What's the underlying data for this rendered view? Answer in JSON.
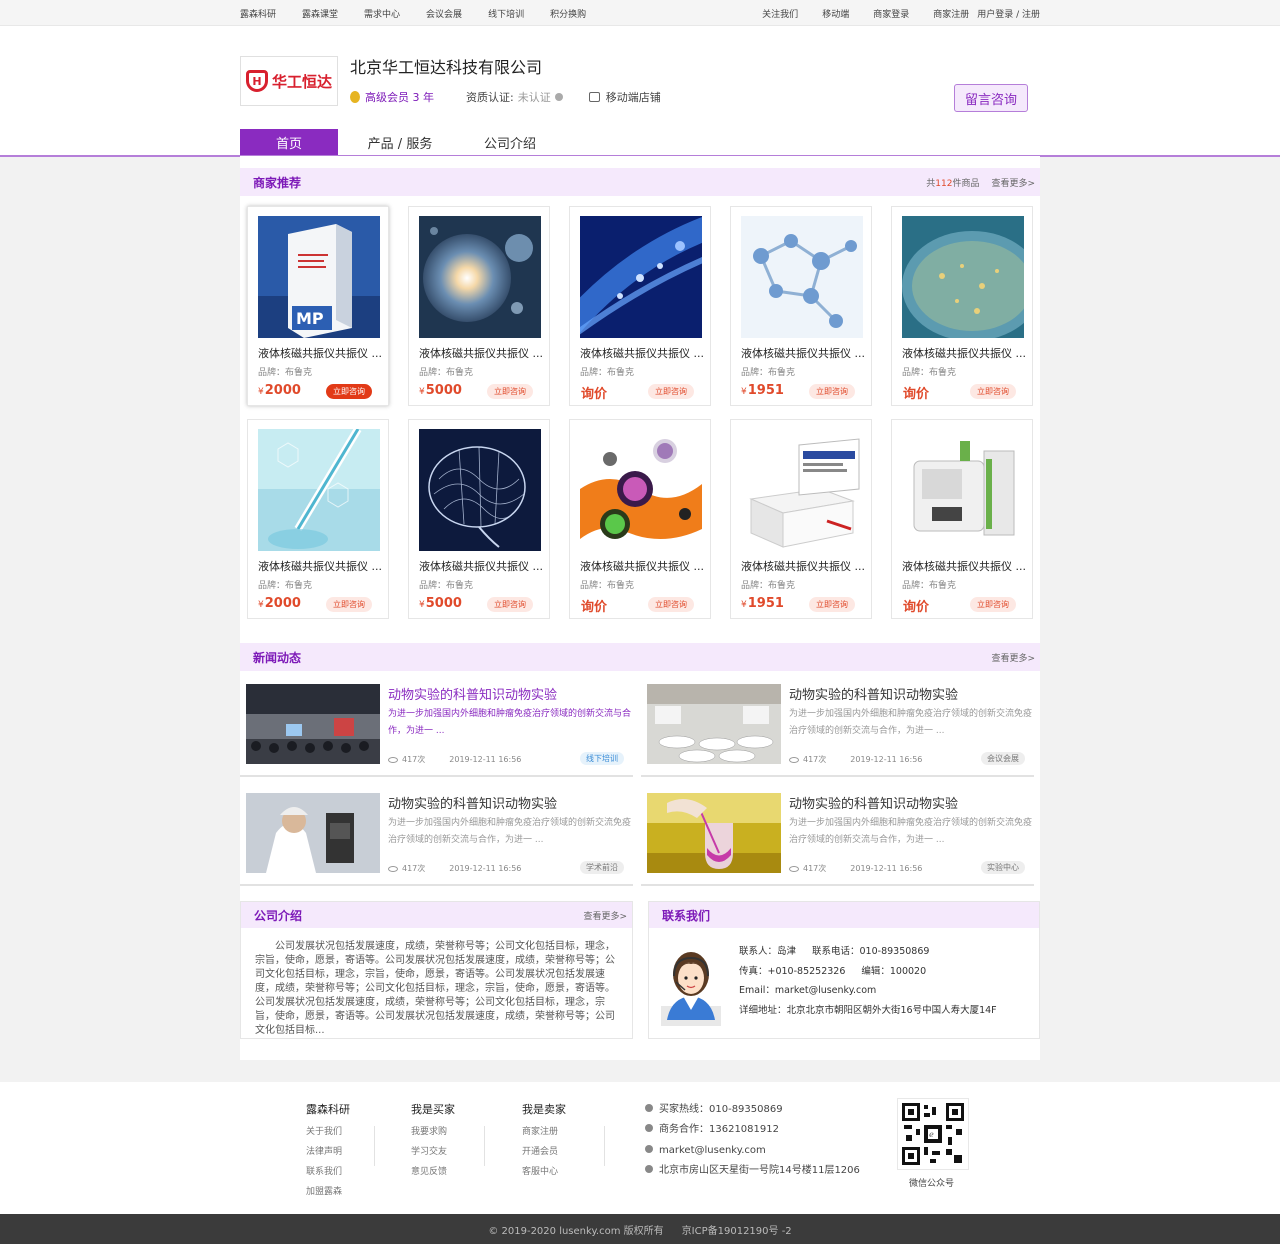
{
  "topnav": {
    "left": [
      "露森科研",
      "露森课堂",
      "需求中心",
      "会议会展",
      "线下培训",
      "积分换购"
    ],
    "right": [
      "关注我们",
      "移动端",
      "商家登录",
      "商家注册"
    ],
    "login": "用户登录 / 注册"
  },
  "header": {
    "logo_text": "华工恒达",
    "company_name": "北京华工恒达科技有限公司",
    "vip": "高级会员 3 年",
    "cert_label": "资质认证:",
    "cert_value": "未认证",
    "mobile_shop": "移动端店铺",
    "consult": "留言咨询"
  },
  "tabs": [
    "首页",
    "产品 / 服务",
    "公司介绍"
  ],
  "recommend": {
    "title": "商家推荐",
    "count_prefix": "共",
    "count": "112",
    "count_suffix": "件商品",
    "more": "查看更多>"
  },
  "products": [
    {
      "name": "液体核磁共振仪共振仪 ...",
      "brand": "品牌：布鲁克",
      "price": "2000",
      "yen": "¥",
      "btn": "立即咨询"
    },
    {
      "name": "液体核磁共振仪共振仪 ...",
      "brand": "品牌：布鲁克",
      "price": "5000",
      "yen": "¥",
      "btn": "立即咨询"
    },
    {
      "name": "液体核磁共振仪共振仪 ...",
      "brand": "品牌：布鲁克",
      "price": "询价",
      "yen": "",
      "btn": "立即咨询"
    },
    {
      "name": "液体核磁共振仪共振仪 ...",
      "brand": "品牌：布鲁克",
      "price": "1951",
      "yen": "¥",
      "btn": "立即咨询"
    },
    {
      "name": "液体核磁共振仪共振仪 ...",
      "brand": "品牌：布鲁克",
      "price": "询价",
      "yen": "",
      "btn": "立即咨询"
    },
    {
      "name": "液体核磁共振仪共振仪 ...",
      "brand": "品牌：布鲁克",
      "price": "2000",
      "yen": "¥",
      "btn": "立即咨询"
    },
    {
      "name": "液体核磁共振仪共振仪 ...",
      "brand": "品牌：布鲁克",
      "price": "5000",
      "yen": "¥",
      "btn": "立即咨询"
    },
    {
      "name": "液体核磁共振仪共振仪 ...",
      "brand": "品牌：布鲁克",
      "price": "询价",
      "yen": "",
      "btn": "立即咨询"
    },
    {
      "name": "液体核磁共振仪共振仪 ...",
      "brand": "品牌：布鲁克",
      "price": "1951",
      "yen": "¥",
      "btn": "立即咨询"
    },
    {
      "name": "液体核磁共振仪共振仪 ...",
      "brand": "品牌：布鲁克",
      "price": "询价",
      "yen": "",
      "btn": "立即咨询"
    }
  ],
  "news_section": {
    "title": "新闻动态",
    "more": "查看更多>"
  },
  "news": [
    {
      "title": "动物实验的科普知识动物实验",
      "desc": "为进一步加强国内外细胞和肿瘤免疫治疗领域的创新交流与合作，为进一 ...",
      "views": "417次",
      "date": "2019-12-11  16:56",
      "tag": "线下培训"
    },
    {
      "title": "动物实验的科普知识动物实验",
      "desc": "为进一步加强国内外细胞和肿瘤免疫治疗领域的创新交流免疫治疗领域的创新交流与合作，为进一 ...",
      "views": "417次",
      "date": "2019-12-11  16:56",
      "tag": "会议会展"
    },
    {
      "title": "动物实验的科普知识动物实验",
      "desc": "为进一步加强国内外细胞和肿瘤免疫治疗领域的创新交流免疫治疗领域的创新交流与合作，为进一 ...",
      "views": "417次",
      "date": "2019-12-11  16:56",
      "tag": "学术前沿"
    },
    {
      "title": "动物实验的科普知识动物实验",
      "desc": "为进一步加强国内外细胞和肿瘤免疫治疗领域的创新交流免疫治疗领域的创新交流与合作，为进一 ...",
      "views": "417次",
      "date": "2019-12-11  16:56",
      "tag": "实验中心"
    }
  ],
  "intro": {
    "title": "公司介绍",
    "more": "查看更多>",
    "text": "公司发展状况包括发展速度，成绩，荣誉称号等；公司文化包括目标，理念，宗旨，使命，愿景，寄语等。公司发展状况包括发展速度，成绩，荣誉称号等；公司文化包括目标，理念，宗旨，使命，愿景，寄语等。公司发展状况包括发展速度，成绩，荣誉称号等；公司文化包括目标，理念，宗旨，使命，愿景，寄语等。公司发展状况包括发展速度，成绩，荣誉称号等；公司文化包括目标，理念，宗旨，使命，愿景，寄语等。公司发展状况包括发展速度，成绩，荣誉称号等；公司文化包括目标..."
  },
  "contact": {
    "title": "联系我们",
    "person": "联系人：岛津",
    "phone": "联系电话：010-89350869",
    "fax": "传真：+010-85252326",
    "postcode": "编辑：100020",
    "email": "Email：market@lusenky.com",
    "address": "详细地址：北京北京市朝阳区朝外大街16号中国人寿大厦14F"
  },
  "footer": {
    "col1": {
      "title": "露森科研",
      "items": [
        "关于我们",
        "法律声明",
        "联系我们",
        "加盟露森"
      ]
    },
    "col2": {
      "title": "我是买家",
      "items": [
        "我要求购",
        "学习交友",
        "意见反馈"
      ]
    },
    "col3": {
      "title": "我是卖家",
      "items": [
        "商家注册",
        "开通会员",
        "客服中心"
      ]
    },
    "contact": [
      "买家热线：010-89350869",
      "商务合作：13621081912",
      "market@lusenky.com",
      "北京市房山区天星街一号院14号楼11层1206"
    ],
    "qr_label": "微信公众号",
    "copyright": "© 2019-2020 lusenky.com 版权所有",
    "icp": "京ICP备19012190号 -2"
  },
  "colors": {
    "accent": "#8a2bc0",
    "accent_light": "#f5e9fc",
    "price": "#e04a2b",
    "logo": "#d8202e"
  }
}
